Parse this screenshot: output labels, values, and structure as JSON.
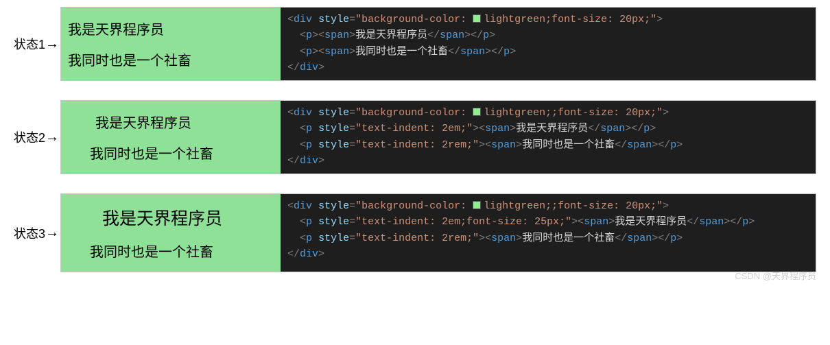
{
  "labels": {
    "s1": "状态1",
    "s2": "状态2",
    "s3": "状态3"
  },
  "arrow": "→",
  "preview_text": {
    "line1": "我是天界程序员",
    "line2": "我同时也是一个社畜"
  },
  "code": {
    "tags": {
      "div": "div",
      "p": "p",
      "span": "span"
    },
    "attr_style": "style",
    "s1_div_style": "\"background-color: ",
    "s1_div_style_after": "lightgreen",
    "s1_div_style_tail": ";font-size: 20px;\"",
    "s2_div_style_tail": ";;font-size: 20px;\"",
    "s3_div_style_tail": ";;font-size: 20px;\"",
    "p_style_2em": "\"text-indent: 2em;\"",
    "p_style_2rem": "\"text-indent: 2rem;\"",
    "p_style_2em_fs25": "\"text-indent: 2em;font-size: 25px;\"",
    "text1": "我是天界程序员",
    "text2": "我同时也是一个社畜",
    "indent2": "  "
  },
  "watermark": "CSDN @天界程序员"
}
